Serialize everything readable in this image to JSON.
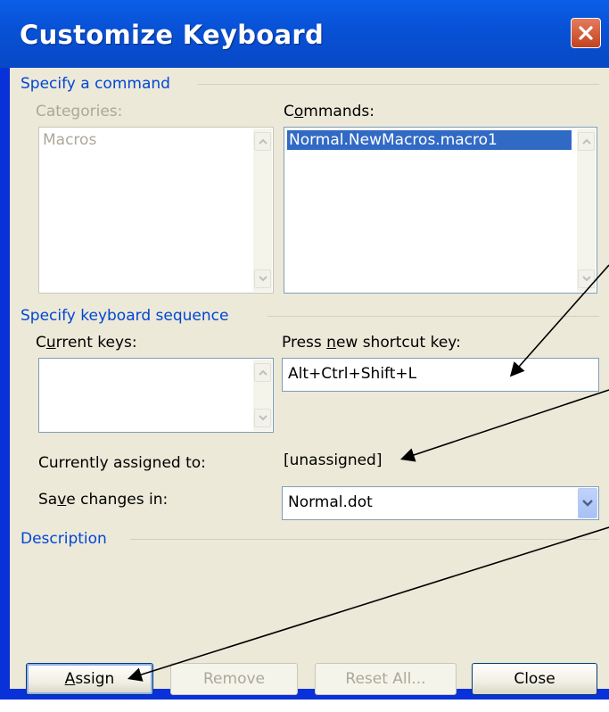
{
  "dialog": {
    "title": "Customize Keyboard",
    "close_icon": "close-icon"
  },
  "command_group": {
    "label": "Specify a command",
    "categories_label": "Categories:",
    "categories_items": [
      "Macros"
    ],
    "commands_label": "Commands:",
    "commands_items": [
      "Normal.NewMacros.macro1"
    ],
    "commands_selected": "Normal.NewMacros.macro1"
  },
  "keyboard_group": {
    "label": "Specify keyboard sequence",
    "current_keys_label": "Current keys:",
    "press_new_label": "Press new shortcut key:",
    "shortcut_value": "Alt+Ctrl+Shift+L",
    "assigned_label": "Currently assigned to:",
    "assigned_value": "[unassigned]",
    "save_in_label": "Save changes in:",
    "save_in_value": "Normal.dot"
  },
  "description_group": {
    "label": "Description"
  },
  "buttons": {
    "assign": "Assign",
    "remove": "Remove",
    "reset_all": "Reset All...",
    "close": "Close"
  },
  "colors": {
    "title_bar": "#0a5ee8",
    "panel": "#ece9d8",
    "group_label": "#0046d5",
    "selection": "#316ac5"
  }
}
